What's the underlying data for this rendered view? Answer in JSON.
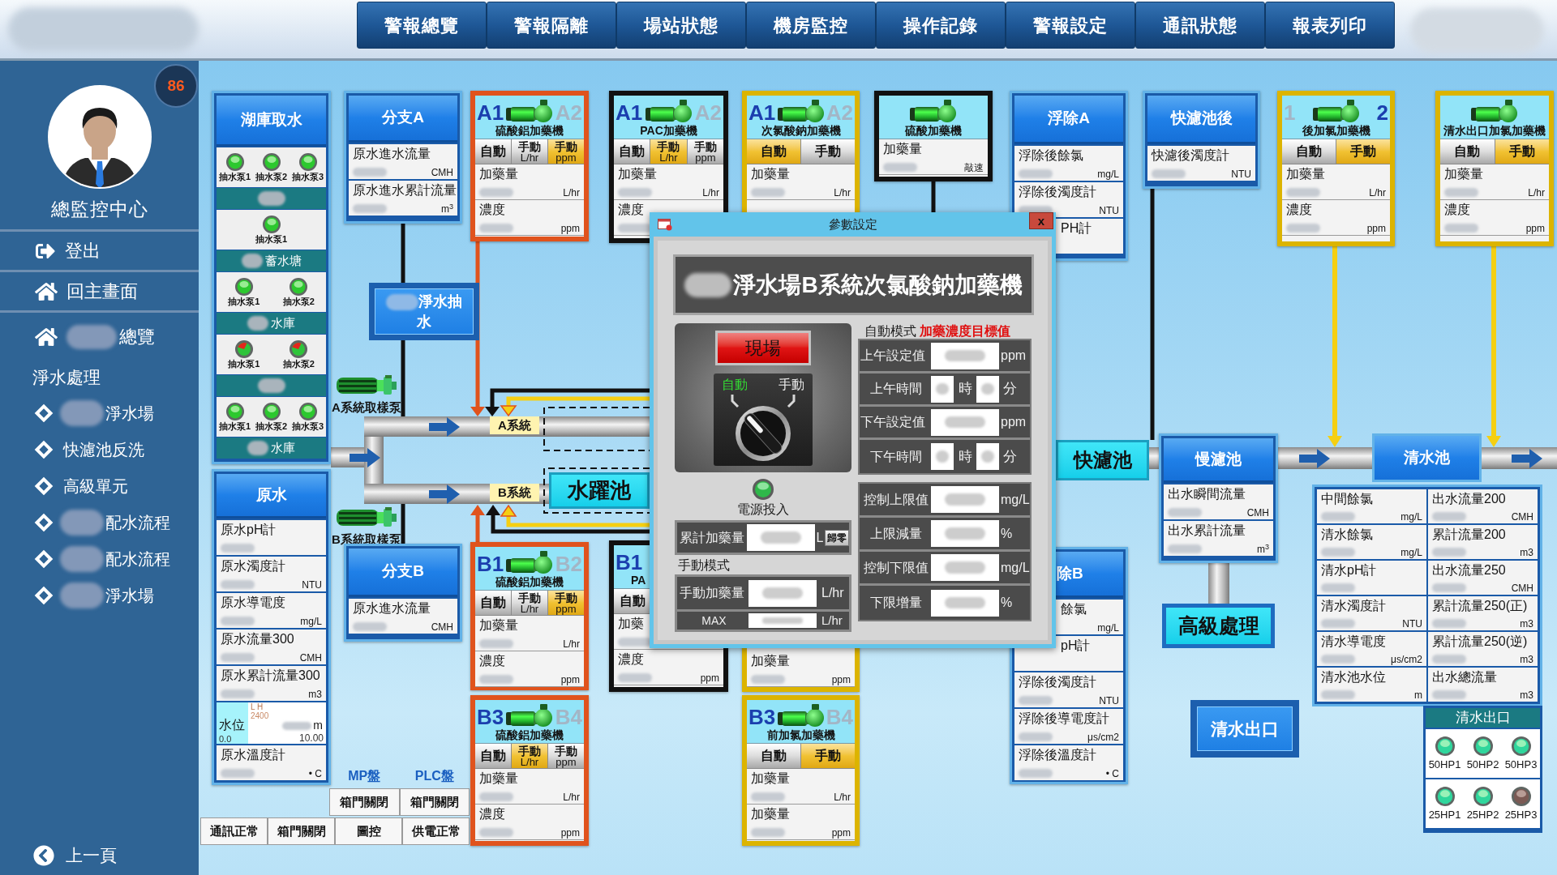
{
  "top_bar": {
    "nav": [
      "警報總覽",
      "警報隔離",
      "場站狀態",
      "機房監控",
      "操作記錄",
      "警報設定",
      "通訊狀態",
      "報表列印"
    ]
  },
  "sidebar": {
    "alarm_count": "86",
    "user": "總監控中心",
    "menu": [
      {
        "kind": "logout",
        "label": "登出",
        "redacted": false
      },
      {
        "kind": "home",
        "label": "回主畫面",
        "redacted": false
      },
      {
        "kind": "home",
        "label": "總覽",
        "redacted": true
      }
    ],
    "section": {
      "title": "淨水處理",
      "items": [
        {
          "label": "淨水場",
          "redacted": true
        },
        {
          "label": "快濾池反洗",
          "redacted": false
        },
        {
          "label": "高級單元",
          "redacted": false
        },
        {
          "label": "配水流程",
          "redacted": true
        },
        {
          "label": "配水流程",
          "redacted": true
        },
        {
          "label": "淨水場",
          "redacted": true
        }
      ]
    },
    "back": "上一頁"
  },
  "intake": {
    "title": "湖庫取水",
    "sections": [
      {
        "kind": "pumps",
        "pumps": [
          {
            "label": "抽水泵1",
            "running": true,
            "fault": false
          },
          {
            "label": "抽水泵2",
            "running": true,
            "fault": false
          },
          {
            "label": "抽水泵3",
            "running": true,
            "fault": false
          }
        ]
      },
      {
        "kind": "bar",
        "redacted": true
      },
      {
        "kind": "pumps",
        "pumps": [
          {
            "label": "抽水泵1",
            "running": true,
            "fault": false
          }
        ]
      },
      {
        "kind": "bar",
        "label": "蓄水塘",
        "redacted": true
      },
      {
        "kind": "pumps",
        "pumps": [
          {
            "label": "抽水泵1",
            "running": true,
            "fault": false
          },
          {
            "label": "抽水泵2",
            "running": true,
            "fault": false
          }
        ]
      },
      {
        "kind": "bar",
        "label": "水庫",
        "redacted": true
      },
      {
        "kind": "pumps",
        "pumps": [
          {
            "label": "抽水泵1",
            "fault": true
          },
          {
            "label": "抽水泵2",
            "fault": true
          }
        ]
      },
      {
        "kind": "bar",
        "redacted": true
      },
      {
        "kind": "pumps",
        "pumps": [
          {
            "label": "抽水泵1",
            "running": true,
            "fault": false
          },
          {
            "label": "抽水泵2",
            "running": true,
            "fault": false
          },
          {
            "label": "抽水泵3",
            "running": true,
            "fault": false
          }
        ]
      },
      {
        "kind": "bar",
        "label": "水庫",
        "redacted": true
      }
    ]
  },
  "raw_water": {
    "title": "原水",
    "rows": [
      {
        "kind": "reading",
        "label": "原水pH計"
      },
      {
        "kind": "reading",
        "label": "原水濁度計",
        "unit": "NTU"
      },
      {
        "kind": "reading",
        "label": "原水導電度",
        "unit": "mg/L"
      },
      {
        "kind": "reading",
        "label": "原水流量300",
        "unit": "CMH"
      },
      {
        "kind": "reading",
        "label": "原水累計流量300",
        "unit": "m3"
      },
      {
        "kind": "gauge",
        "label": "水位",
        "level": 0.29,
        "marks": "L H",
        "setpoint": "2400",
        "min": "0.0",
        "unit": "m",
        "max": "10.00"
      },
      {
        "kind": "reading",
        "label": "原水溫度計",
        "unit": "• C"
      }
    ]
  },
  "branch_a": {
    "title": "分支A",
    "rows": [
      {
        "label": "原水進水流量",
        "unit": "CMH"
      },
      {
        "label": "原水進水累計流量",
        "unit": "m$^{3}$"
      }
    ]
  },
  "pump_station": {
    "label": "淨水抽水",
    "redacted": true
  },
  "sampling_pumps": [
    {
      "label": "A系統取樣泵"
    },
    {
      "label": "B系統取樣泵"
    }
  ],
  "pipe_labels": [
    "A系統",
    "B系統"
  ],
  "hydraulic_jump_tank": "水躍池",
  "branch_b": {
    "title": "分支B",
    "rows": [
      {
        "label": "原水進水流量",
        "unit": "CMH"
      }
    ]
  },
  "panel_status": {
    "headers": [
      "MP盤",
      "PLC盤"
    ],
    "upper": [
      "箱門關閉",
      "箱門關閉"
    ],
    "lower": [
      "通訊正常",
      "箱門關閉",
      "圖控",
      "供電正常"
    ]
  },
  "feeders": [
    {
      "units": [
        {
          "label": "A1",
          "selected": true
        },
        {
          "label": "A2",
          "selected": false
        }
      ],
      "name": "硫酸鋁加藥機",
      "color": "#e0531d",
      "modes": [
        {
          "label": "自動",
          "selected": false
        },
        {
          "label": "手動",
          "unit": "L/hr",
          "selected": false
        },
        {
          "label": "手動",
          "unit": "ppm",
          "selected": true
        }
      ],
      "rows": [
        {
          "label": "加藥量",
          "unit": "L/hr"
        },
        {
          "label": "濃度",
          "unit": "ppm"
        }
      ]
    },
    {
      "units": [
        {
          "label": "A1",
          "selected": true
        },
        {
          "label": "A2",
          "selected": false
        }
      ],
      "name": "PAC加藥機",
      "color": "#111111",
      "modes": [
        {
          "label": "自動",
          "selected": false
        },
        {
          "label": "手動",
          "unit": "L/hr",
          "selected": true
        },
        {
          "label": "手動",
          "unit": "ppm",
          "selected": false
        }
      ],
      "rows": [
        {
          "label": "加藥量",
          "unit": "L/hr"
        },
        {
          "label": "濃度"
        }
      ]
    },
    {
      "units": [
        {
          "label": "A1",
          "selected": true
        },
        {
          "label": "A2",
          "selected": false
        }
      ],
      "name": "次氯酸鈉加藥機",
      "color": "#dcb400",
      "modes": [
        {
          "label": "自動",
          "selected": true
        },
        {
          "label": "手動",
          "selected": false
        }
      ],
      "rows": [
        {
          "label": "加藥量",
          "unit": "L/hr"
        }
      ]
    },
    {
      "name": "硫酸加藥機",
      "color": "#111111",
      "rows": [
        {
          "label": "加藥量",
          "unit": "敲速"
        }
      ]
    },
    {
      "units": [
        {
          "label": "1",
          "selected": false
        },
        {
          "label": "2",
          "selected": true
        }
      ],
      "name": "後加氯加藥機",
      "color": "#dcb400",
      "modes": [
        {
          "label": "自動",
          "selected": false
        },
        {
          "label": "手動",
          "selected": true
        }
      ],
      "rows": [
        {
          "label": "加藥量",
          "unit": "L/hr"
        },
        {
          "label": "濃度",
          "unit": "ppm"
        }
      ]
    },
    {
      "name": "清水出口加氯加藥機",
      "color": "#dcb400",
      "modes": [
        {
          "label": "自動",
          "selected": false
        },
        {
          "label": "手動",
          "selected": true
        }
      ],
      "rows": [
        {
          "label": "加藥量",
          "unit": "L/hr"
        },
        {
          "label": "濃度",
          "unit": "ppm"
        }
      ]
    },
    {
      "units": [
        {
          "label": "B1",
          "selected": true
        },
        {
          "label": "B2",
          "selected": false
        }
      ],
      "name": "硫酸鋁加藥機",
      "color": "#e0531d",
      "modes": [
        {
          "label": "自動",
          "selected": false
        },
        {
          "label": "手動",
          "unit": "L/hr",
          "selected": false
        },
        {
          "label": "手動",
          "unit": "ppm",
          "selected": true
        }
      ],
      "rows": [
        {
          "label": "加藥量",
          "unit": "L/hr"
        },
        {
          "label": "濃度",
          "unit": "ppm"
        }
      ]
    },
    {
      "units": [
        {
          "label": "B1",
          "selected": true
        }
      ],
      "name": "PA",
      "color": "#111111",
      "modes": [
        {
          "label": "自動",
          "selected": false
        }
      ],
      "rows": [
        {
          "label": "加藥"
        },
        {
          "label": "濃度",
          "unit": "ppm"
        }
      ]
    },
    {
      "color": "#dcb400",
      "rows": [
        {
          "label": "加藥量",
          "unit": "ppm"
        }
      ]
    },
    {
      "units": [
        {
          "label": "B3",
          "selected": true
        },
        {
          "label": "B4",
          "selected": false
        }
      ],
      "name": "硫酸鋁加藥機",
      "color": "#e0531d",
      "modes": [
        {
          "label": "自動",
          "selected": false
        },
        {
          "label": "手動",
          "unit": "L/hr",
          "selected": true
        },
        {
          "label": "手動",
          "unit": "ppm",
          "selected": false
        }
      ],
      "rows": [
        {
          "label": "加藥量",
          "unit": "L/hr"
        },
        {
          "label": "濃度",
          "unit": "ppm"
        }
      ]
    },
    {
      "units": [
        {
          "label": "B3",
          "selected": true
        },
        {
          "label": "B4",
          "selected": false
        }
      ],
      "name": "前加氯加藥機",
      "color": "#dcb400",
      "modes": [
        {
          "label": "自動",
          "selected": false
        },
        {
          "label": "手動",
          "selected": true
        }
      ],
      "rows": [
        {
          "label": "加藥量",
          "unit": "L/hr"
        },
        {
          "label": "加藥量",
          "unit": "ppm"
        }
      ]
    }
  ],
  "flotation_a": {
    "title": "浮除A",
    "rows": [
      {
        "label": "浮除後餘氯",
        "unit": "mg/L"
      },
      {
        "label": "浮除後濁度計",
        "unit": "NTU"
      },
      {
        "label": "PH計",
        "clipped": true
      }
    ]
  },
  "rapid_filter_outlet": {
    "title": "快濾池後",
    "rows": [
      {
        "label": "快濾後濁度計",
        "unit": "NTU"
      }
    ]
  },
  "dialog": {
    "title": "參數設定",
    "close": "x",
    "heading": "淨水場B系統次氯酸鈉加藥機",
    "heading_redacted": true,
    "location": "現場",
    "selector": [
      {
        "label": "自動",
        "selected": true
      },
      {
        "label": "手動",
        "selected": false
      }
    ],
    "power": {
      "label": "電源投入",
      "on": true
    },
    "total": {
      "label": "累計加藥量",
      "unit": "L",
      "button": "歸零"
    },
    "manual": {
      "title": "手動模式",
      "rows": [
        {
          "kind": "value",
          "label": "手動加藥量",
          "unit": "L/hr"
        },
        {
          "kind": "max",
          "label": "MAX",
          "unit": "L/hr"
        }
      ]
    },
    "auto": {
      "title": "自動模式",
      "target": "加藥濃度目標值",
      "schedule": [
        {
          "kind": "value",
          "label": "上午設定值",
          "unit": "ppm"
        },
        {
          "kind": "time",
          "label": "上午時間",
          "hour": "時",
          "minute": "分"
        },
        {
          "kind": "value",
          "label": "下午設定值",
          "unit": "ppm"
        },
        {
          "kind": "time",
          "label": "下午時間",
          "hour": "時",
          "minute": "分"
        }
      ],
      "limits": [
        {
          "label": "控制上限值",
          "unit": "mg/L"
        },
        {
          "label": "上限減量",
          "unit": "%"
        },
        {
          "label": "控制下限值",
          "unit": "mg/L"
        },
        {
          "label": "下限增量",
          "unit": "%"
        }
      ]
    }
  },
  "rapid_filter": "快濾池",
  "flotation_b": {
    "title": "除B",
    "clipped": true,
    "rows": [
      {
        "label": "餘氯",
        "unit": "mg/L",
        "clipped": true
      },
      {
        "label": "pH計",
        "clipped": true
      },
      {
        "label": "浮除後濁度計",
        "unit": "NTU"
      },
      {
        "label": "浮除後導電度計",
        "unit": "μs/cm2"
      },
      {
        "label": "浮除後溫度計",
        "unit": "• C"
      }
    ]
  },
  "slow_filter": {
    "title": "慢濾池",
    "rows": [
      {
        "label": "出水瞬間流量",
        "unit": "CMH"
      },
      {
        "label": "出水累計流量",
        "unit": "m$^{3}$"
      }
    ]
  },
  "advanced_treatment": "高級處理",
  "clear_water_outlet": "清水出口",
  "clear_water_tank": {
    "title": "清水池",
    "readings": [
      {
        "label": "中間餘氯",
        "unit": "mg/L"
      },
      {
        "label": "出水流量200",
        "unit": "CMH"
      },
      {
        "label": "清水餘氯",
        "unit": "mg/L"
      },
      {
        "label": "累計流量200",
        "unit": "m3"
      },
      {
        "label": "清水pH計"
      },
      {
        "label": "出水流量250",
        "unit": "CMH"
      },
      {
        "label": "清水濁度計",
        "unit": "NTU"
      },
      {
        "label": "累計流量250(正)",
        "unit": "m3"
      },
      {
        "label": "清水導電度",
        "unit": "μs/cm2"
      },
      {
        "label": "累計流量250(逆)",
        "unit": "m3"
      },
      {
        "label": "清水池水位",
        "unit": "m"
      },
      {
        "label": "出水總流量",
        "unit": "m3"
      }
    ]
  },
  "outlet_pumps": {
    "title": "清水出口",
    "pumps": [
      {
        "label": "50HP1",
        "running": true
      },
      {
        "label": "50HP2",
        "running": true
      },
      {
        "label": "50HP3",
        "running": true
      },
      {
        "label": "25HP1",
        "running": true
      },
      {
        "label": "25HP2",
        "running": true
      },
      {
        "label": "25HP3",
        "running": false
      }
    ]
  }
}
